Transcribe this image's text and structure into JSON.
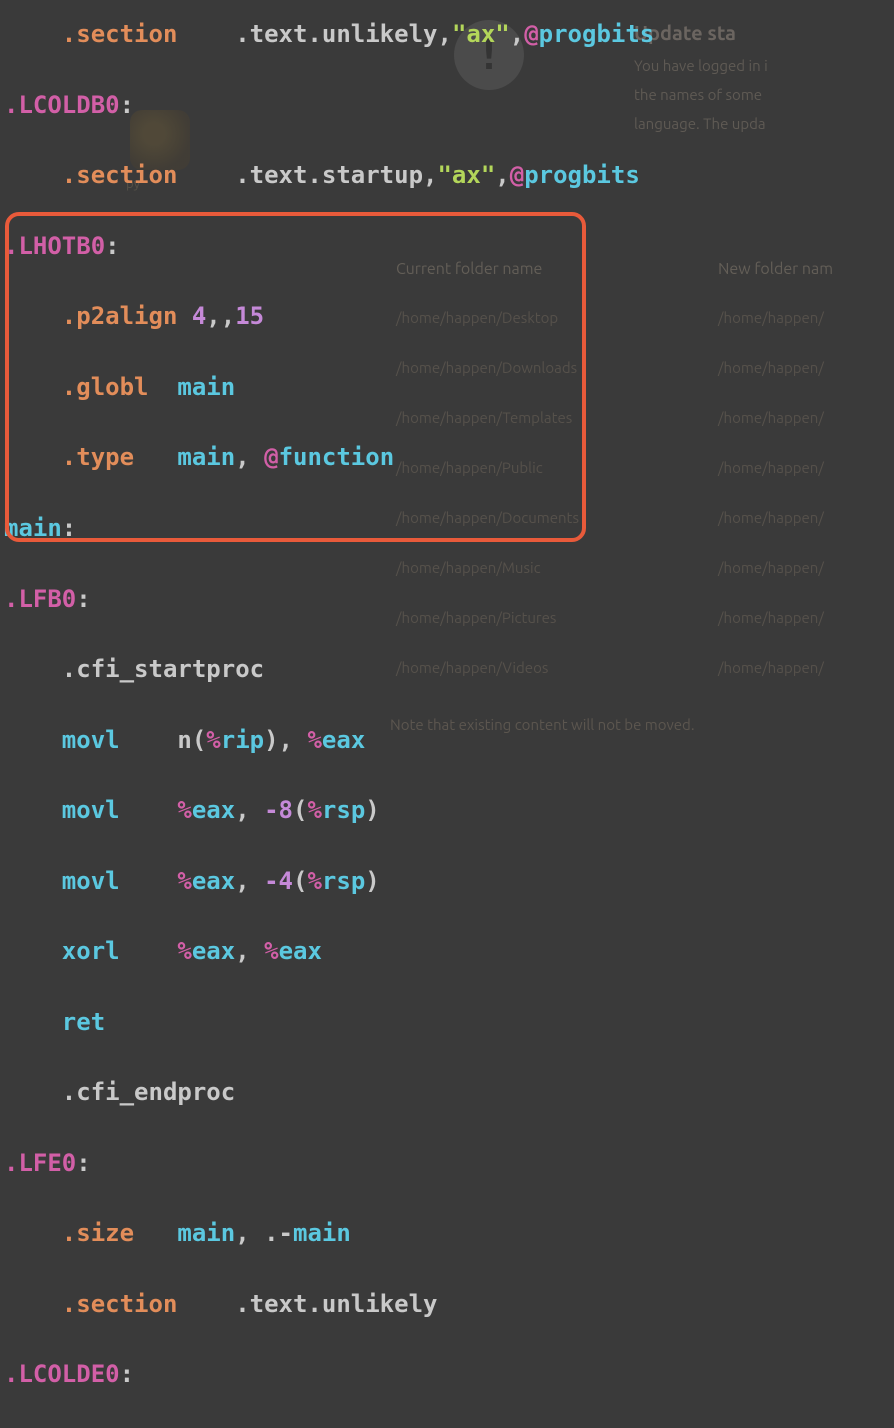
{
  "code": {
    "l0": {
      "indent": "    ",
      "d": ".section",
      "t1": "    .text.unlikely,",
      "s": "\"ax\"",
      "c": ",",
      "at": "@",
      "pb": "progbits"
    },
    "l1": {
      "lbl": ".LCOLDB0"
    },
    "l2": {
      "indent": "    ",
      "d": ".section",
      "t1": "    .text.startup,",
      "s": "\"ax\"",
      "c": ",",
      "at": "@",
      "pb": "progbits"
    },
    "l3": {
      "lbl": ".LHOTB0"
    },
    "l4": {
      "indent": "    ",
      "d": ".p2align",
      "sp": " ",
      "n1": "4",
      "c1": ",,",
      "n2": "15"
    },
    "l5": {
      "indent": "    ",
      "d": ".globl",
      "sp": "  ",
      "m": "main"
    },
    "l6": {
      "indent": "    ",
      "d": ".type",
      "sp": "   ",
      "m": "main",
      "c": ", ",
      "at": "@",
      "fn": "function"
    },
    "l7": {
      "m": "main"
    },
    "l8": {
      "lbl": ".LFB0"
    },
    "l9": {
      "indent": "    ",
      "t": ".cfi_startproc"
    },
    "l10": {
      "indent": "    ",
      "ins": "movl",
      "sp": "    ",
      "a1": "n",
      "p1": "(",
      "pc1": "%",
      "r1": "rip",
      "p2": "), ",
      "pc2": "%",
      "r2": "eax"
    },
    "l11": {
      "indent": "    ",
      "ins": "movl",
      "sp": "    ",
      "pc1": "%",
      "r1": "eax",
      "c": ", ",
      "n": "-8",
      "p1": "(",
      "pc2": "%",
      "r2": "rsp",
      "p2": ")"
    },
    "l12": {
      "indent": "    ",
      "ins": "movl",
      "sp": "    ",
      "pc1": "%",
      "r1": "eax",
      "c": ", ",
      "n": "-4",
      "p1": "(",
      "pc2": "%",
      "r2": "rsp",
      "p2": ")"
    },
    "l13": {
      "indent": "    ",
      "ins": "xorl",
      "sp": "    ",
      "pc1": "%",
      "r1": "eax",
      "c": ", ",
      "pc2": "%",
      "r2": "eax"
    },
    "l14": {
      "indent": "    ",
      "ins": "ret"
    },
    "l15": {
      "indent": "    ",
      "t": ".cfi_endproc"
    },
    "l16": {
      "lbl": ".LFE0"
    },
    "l17": {
      "indent": "    ",
      "d": ".size",
      "sp": "   ",
      "m1": "main",
      "c": ", .-",
      "m2": "main"
    },
    "l18": {
      "indent": "    ",
      "d": ".section",
      "sp": "    ",
      "t": ".text.unlikely"
    },
    "l19": {
      "lbl": ".LCOLDE0"
    }
  },
  "notif": {
    "title": "Update sta",
    "line1": "You have logged in i",
    "line2": "the names of some",
    "line3": "language. The upda"
  },
  "thumb_label": "py",
  "table": {
    "h1": "Current folder name",
    "h2": "New folder nam",
    "rows": [
      {
        "c": "/home/happen/Desktop",
        "n": "/home/happen/"
      },
      {
        "c": "/home/happen/Downloads",
        "n": "/home/happen/"
      },
      {
        "c": "/home/happen/Templates",
        "n": "/home/happen/"
      },
      {
        "c": "/home/happen/Public",
        "n": "/home/happen/"
      },
      {
        "c": "/home/happen/Documents",
        "n": "/home/happen/"
      },
      {
        "c": "/home/happen/Music",
        "n": "/home/happen/"
      },
      {
        "c": "/home/happen/Pictures",
        "n": "/home/happen/"
      },
      {
        "c": "/home/happen/Videos",
        "n": "/home/happen/"
      }
    ]
  },
  "note": "Note that existing content will not be moved."
}
